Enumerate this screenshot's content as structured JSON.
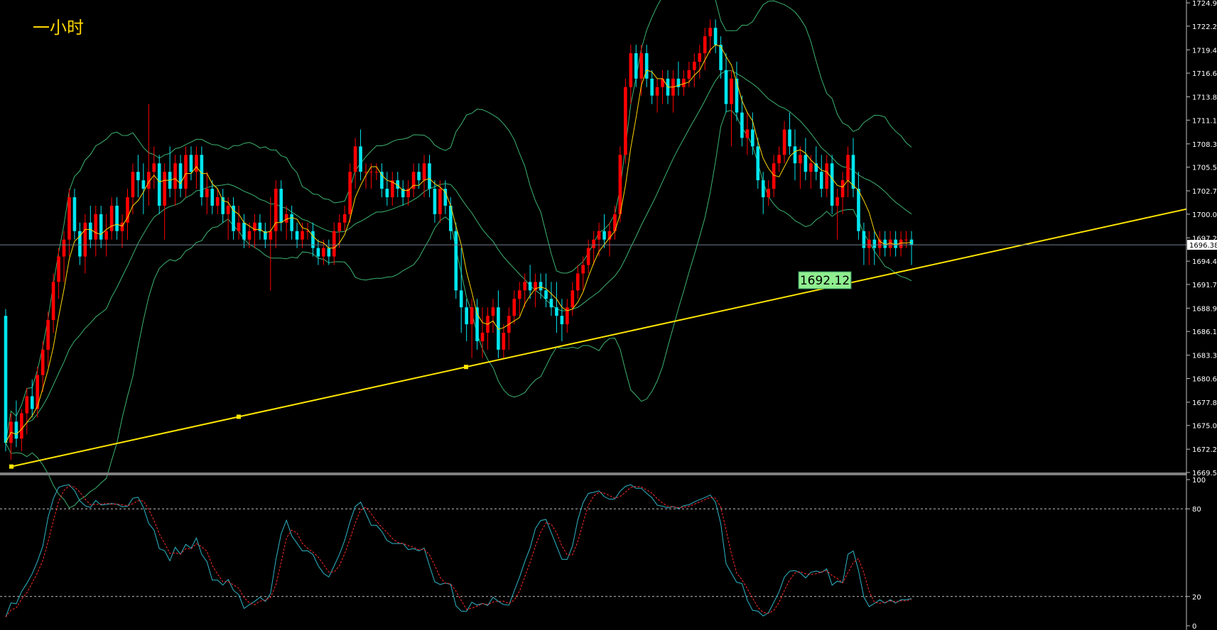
{
  "chart_data": {
    "type": "candlestick",
    "timeframe_label": "一小时",
    "main_axis": {
      "ylim": [
        1669.5,
        1724.95
      ],
      "ticks": [
        "1724.95",
        "1722.20",
        "1719.40",
        "1716.65",
        "1713.85",
        "1711.10",
        "1708.30",
        "1705.55",
        "1702.75",
        "1700.00",
        "1697.20",
        "1694.45",
        "1691.70",
        "1688.90",
        "1686.15",
        "1683.35",
        "1680.60",
        "1677.80",
        "1675.05",
        "1672.25",
        "1669.50"
      ]
    },
    "current_price": "1696.38",
    "current_price_value": 1696.38,
    "trendline": {
      "from_value": 1670.2,
      "to_value": 1700.6
    },
    "trendline_label": "1692.12",
    "candles": [
      [
        1688,
        1688.8,
        1672,
        1673
      ],
      [
        1673,
        1676.5,
        1671,
        1675.5
      ],
      [
        1675.5,
        1678,
        1672.5,
        1673.5
      ],
      [
        1673.5,
        1677,
        1672,
        1676.5
      ],
      [
        1676.5,
        1679.5,
        1674,
        1678.5
      ],
      [
        1678.5,
        1680.5,
        1676,
        1677
      ],
      [
        1677,
        1682,
        1676,
        1681
      ],
      [
        1681,
        1685,
        1679,
        1684
      ],
      [
        1684,
        1688.5,
        1682,
        1687.5
      ],
      [
        1687.5,
        1693,
        1686,
        1692
      ],
      [
        1692,
        1696,
        1690,
        1695
      ],
      [
        1695,
        1698,
        1692,
        1697
      ],
      [
        1697,
        1703,
        1695,
        1702
      ],
      [
        1702,
        1703,
        1697,
        1698
      ],
      [
        1698,
        1699,
        1694,
        1695
      ],
      [
        1695,
        1700,
        1693,
        1699
      ],
      [
        1699,
        1701,
        1696,
        1697
      ],
      [
        1697,
        1701,
        1695,
        1700
      ],
      [
        1700,
        1701,
        1696,
        1697
      ],
      [
        1697,
        1700,
        1695,
        1698
      ],
      [
        1698,
        1702,
        1697,
        1701
      ],
      [
        1701,
        1702,
        1697,
        1698
      ],
      [
        1698,
        1700,
        1696,
        1699
      ],
      [
        1699,
        1703,
        1697,
        1702
      ],
      [
        1702,
        1706,
        1700,
        1705
      ],
      [
        1705,
        1707,
        1702,
        1704
      ],
      [
        1704,
        1706,
        1700,
        1703
      ],
      [
        1703,
        1713,
        1701,
        1705
      ],
      [
        1705,
        1708,
        1703,
        1706
      ],
      [
        1706,
        1707,
        1700,
        1701
      ],
      [
        1701,
        1706,
        1697,
        1705
      ],
      [
        1705,
        1708,
        1702,
        1703
      ],
      [
        1703,
        1707,
        1701,
        1706
      ],
      [
        1706,
        1707,
        1702,
        1703
      ],
      [
        1703,
        1708,
        1702,
        1707
      ],
      [
        1707,
        1708,
        1704,
        1705
      ],
      [
        1705,
        1708,
        1703,
        1707
      ],
      [
        1707,
        1708,
        1701,
        1702
      ],
      [
        1702,
        1705,
        1700,
        1703
      ],
      [
        1703,
        1704,
        1700,
        1701
      ],
      [
        1701,
        1703,
        1700,
        1702
      ],
      [
        1702,
        1703,
        1699,
        1700
      ],
      [
        1700,
        1702,
        1697,
        1701
      ],
      [
        1701,
        1702,
        1697,
        1698
      ],
      [
        1698,
        1701,
        1697,
        1699
      ],
      [
        1699,
        1700,
        1696,
        1697
      ],
      [
        1697,
        1699,
        1696,
        1698
      ],
      [
        1698,
        1700,
        1696,
        1699
      ],
      [
        1699,
        1700,
        1697,
        1698
      ],
      [
        1698,
        1699,
        1696,
        1697
      ],
      [
        1697,
        1702,
        1691,
        1698
      ],
      [
        1698,
        1704,
        1696,
        1703
      ],
      [
        1703,
        1704,
        1698,
        1699
      ],
      [
        1699,
        1701,
        1697,
        1700
      ],
      [
        1700,
        1701,
        1697,
        1698
      ],
      [
        1698,
        1699,
        1696,
        1697
      ],
      [
        1697,
        1699,
        1696,
        1698
      ],
      [
        1698,
        1699,
        1697,
        1698
      ],
      [
        1698,
        1699,
        1695,
        1696
      ],
      [
        1696,
        1697,
        1694,
        1695
      ],
      [
        1695,
        1697,
        1694,
        1696
      ],
      [
        1696,
        1697,
        1694,
        1695
      ],
      [
        1695,
        1699,
        1694,
        1698
      ],
      [
        1698,
        1700,
        1696,
        1699
      ],
      [
        1699,
        1701,
        1698,
        1700
      ],
      [
        1700,
        1706,
        1699,
        1705
      ],
      [
        1705,
        1709,
        1703,
        1708
      ],
      [
        1708,
        1710,
        1704,
        1705
      ],
      [
        1705,
        1706,
        1703,
        1705
      ],
      [
        1705,
        1706,
        1703,
        1705
      ],
      [
        1705,
        1706,
        1704,
        1705
      ],
      [
        1705,
        1706,
        1702,
        1703
      ],
      [
        1703,
        1705,
        1701,
        1702
      ],
      [
        1702,
        1705,
        1701,
        1704
      ],
      [
        1704,
        1705,
        1702,
        1703
      ],
      [
        1703,
        1704,
        1701,
        1702
      ],
      [
        1702,
        1704,
        1701,
        1703
      ],
      [
        1703,
        1706,
        1702,
        1705
      ],
      [
        1705,
        1706,
        1703,
        1704
      ],
      [
        1704,
        1707,
        1702,
        1706
      ],
      [
        1706,
        1707,
        1702,
        1703
      ],
      [
        1703,
        1704,
        1699,
        1700
      ],
      [
        1700,
        1704,
        1699,
        1703
      ],
      [
        1703,
        1704,
        1700,
        1701
      ],
      [
        1701,
        1702,
        1697,
        1698
      ],
      [
        1698,
        1699,
        1690,
        1691
      ],
      [
        1691,
        1696,
        1686,
        1689
      ],
      [
        1689,
        1690,
        1685,
        1687
      ],
      [
        1687,
        1690,
        1683,
        1689
      ],
      [
        1689,
        1690,
        1684,
        1685
      ],
      [
        1685,
        1689,
        1683,
        1686
      ],
      [
        1686,
        1689,
        1684,
        1688
      ],
      [
        1688,
        1690,
        1686,
        1689
      ],
      [
        1689,
        1691,
        1683,
        1684
      ],
      [
        1684,
        1687,
        1683,
        1686
      ],
      [
        1686,
        1689,
        1684,
        1688
      ],
      [
        1688,
        1691,
        1687,
        1690
      ],
      [
        1690,
        1692,
        1688,
        1691
      ],
      [
        1691,
        1693,
        1689,
        1692
      ],
      [
        1692,
        1694,
        1690,
        1691
      ],
      [
        1691,
        1693,
        1689,
        1692
      ],
      [
        1692,
        1693,
        1690,
        1691
      ],
      [
        1691,
        1693,
        1689,
        1690
      ],
      [
        1690,
        1692,
        1688,
        1689
      ],
      [
        1689,
        1692,
        1686,
        1688
      ],
      [
        1688,
        1690,
        1685,
        1687
      ],
      [
        1687,
        1690,
        1686,
        1689
      ],
      [
        1689,
        1692,
        1688,
        1691
      ],
      [
        1691,
        1694,
        1690,
        1693
      ],
      [
        1693,
        1695,
        1691,
        1694
      ],
      [
        1694,
        1697,
        1693,
        1696
      ],
      [
        1696,
        1698,
        1694,
        1697
      ],
      [
        1697,
        1699,
        1695,
        1698
      ],
      [
        1698,
        1700,
        1696,
        1697
      ],
      [
        1697,
        1699,
        1695,
        1698
      ],
      [
        1698,
        1701,
        1697,
        1700
      ],
      [
        1700,
        1708,
        1699,
        1707
      ],
      [
        1707,
        1716,
        1706,
        1715
      ],
      [
        1715,
        1720,
        1713,
        1719
      ],
      [
        1719,
        1720,
        1715,
        1716
      ],
      [
        1716,
        1720,
        1714,
        1719
      ],
      [
        1719,
        1720,
        1715,
        1716
      ],
      [
        1716,
        1717,
        1713,
        1714
      ],
      [
        1714,
        1716,
        1712,
        1715
      ],
      [
        1715,
        1717,
        1713,
        1716
      ],
      [
        1716,
        1717,
        1713,
        1714
      ],
      [
        1714,
        1717,
        1712,
        1716
      ],
      [
        1716,
        1718,
        1714,
        1715
      ],
      [
        1715,
        1717,
        1714,
        1716
      ],
      [
        1716,
        1718,
        1715,
        1717
      ],
      [
        1717,
        1719,
        1715,
        1718
      ],
      [
        1718,
        1720,
        1716,
        1719
      ],
      [
        1719,
        1722,
        1717,
        1721
      ],
      [
        1721,
        1723,
        1719,
        1722
      ],
      [
        1722,
        1723,
        1719,
        1720
      ],
      [
        1720,
        1721,
        1716,
        1717
      ],
      [
        1717,
        1719,
        1712,
        1713
      ],
      [
        1713,
        1717,
        1708,
        1716
      ],
      [
        1716,
        1718,
        1711,
        1712
      ],
      [
        1712,
        1714,
        1708,
        1709
      ],
      [
        1709,
        1712,
        1707,
        1710
      ],
      [
        1710,
        1712,
        1707,
        1708
      ],
      [
        1708,
        1709,
        1703,
        1704
      ],
      [
        1704,
        1705,
        1700,
        1702
      ],
      [
        1702,
        1704,
        1701,
        1703
      ],
      [
        1703,
        1707,
        1702,
        1706
      ],
      [
        1706,
        1708,
        1705,
        1707
      ],
      [
        1707,
        1711,
        1706,
        1710
      ],
      [
        1710,
        1712,
        1707,
        1708
      ],
      [
        1708,
        1710,
        1704,
        1706
      ],
      [
        1706,
        1708,
        1703,
        1707
      ],
      [
        1707,
        1709,
        1704,
        1705
      ],
      [
        1705,
        1707,
        1703,
        1706
      ],
      [
        1706,
        1708,
        1704,
        1705
      ],
      [
        1705,
        1707,
        1702,
        1703
      ],
      [
        1703,
        1707,
        1702,
        1706
      ],
      [
        1706,
        1707,
        1700,
        1701
      ],
      [
        1701,
        1703,
        1697,
        1702
      ],
      [
        1702,
        1705,
        1700,
        1704
      ],
      [
        1704,
        1708,
        1702,
        1707
      ],
      [
        1707,
        1709,
        1702,
        1703
      ],
      [
        1703,
        1705,
        1697,
        1698
      ],
      [
        1698,
        1699,
        1694,
        1696
      ],
      [
        1696,
        1698,
        1694,
        1697
      ],
      [
        1697,
        1698,
        1694,
        1696
      ],
      [
        1696,
        1698,
        1695,
        1697
      ],
      [
        1697,
        1698,
        1695,
        1696
      ],
      [
        1696,
        1698,
        1695,
        1697
      ],
      [
        1697,
        1698,
        1695,
        1696
      ],
      [
        1696,
        1698,
        1695,
        1697
      ],
      [
        1697,
        1698,
        1696,
        1697
      ],
      [
        1697,
        1698,
        1694,
        1696.38
      ]
    ],
    "stochastic": {
      "ylim": [
        0,
        100
      ],
      "ticks": [
        "100",
        "80",
        "20",
        "0"
      ],
      "levels": [
        80,
        20
      ]
    }
  },
  "colors": {
    "background": "#000000",
    "bull": "#ff0000",
    "bear": "#00e5ee",
    "bands": "#3cb371",
    "ma": "#ffd700",
    "trendline": "#ffe600",
    "k_line": "#2fb6c8",
    "d_line": "#ff2a2a",
    "label_bg": "#90ee90"
  }
}
